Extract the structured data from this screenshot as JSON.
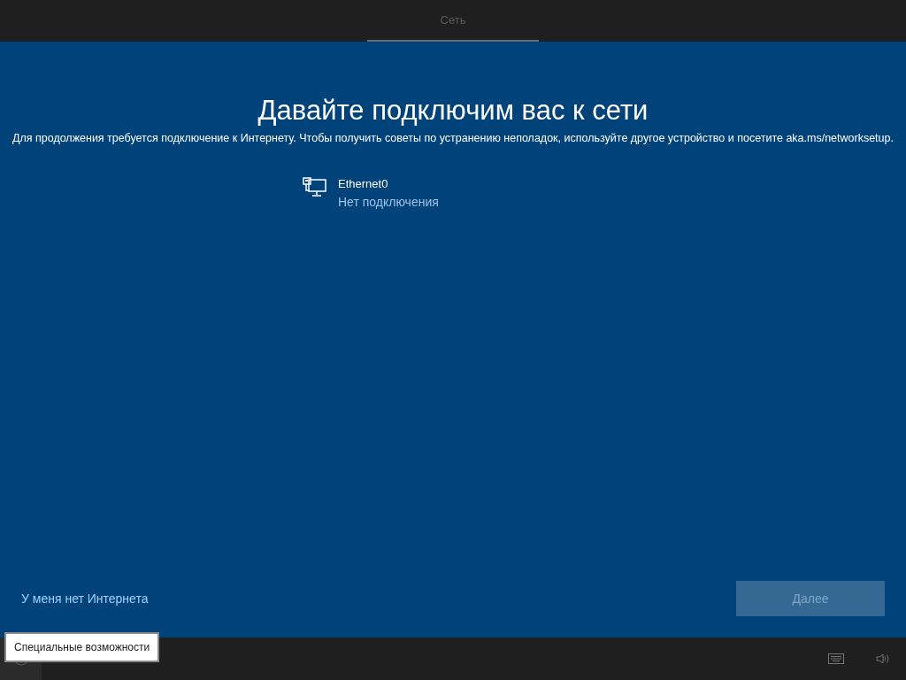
{
  "tabs": [
    {
      "label": "Сеть",
      "selected": true
    }
  ],
  "title": "Давайте подключим вас к сети",
  "subtitle": "Для продолжения требуется подключение к Интернету. Чтобы получить советы по устранению неполадок, используйте другое устройство и посетите aka.ms/networksetup.",
  "networks": [
    {
      "name": "Ethernet0",
      "status": "Нет подключения"
    }
  ],
  "no_internet_link": "У меня нет Интернета",
  "next_button": {
    "label": "Далее",
    "disabled": true
  },
  "tooltip": "Специальные возможности"
}
